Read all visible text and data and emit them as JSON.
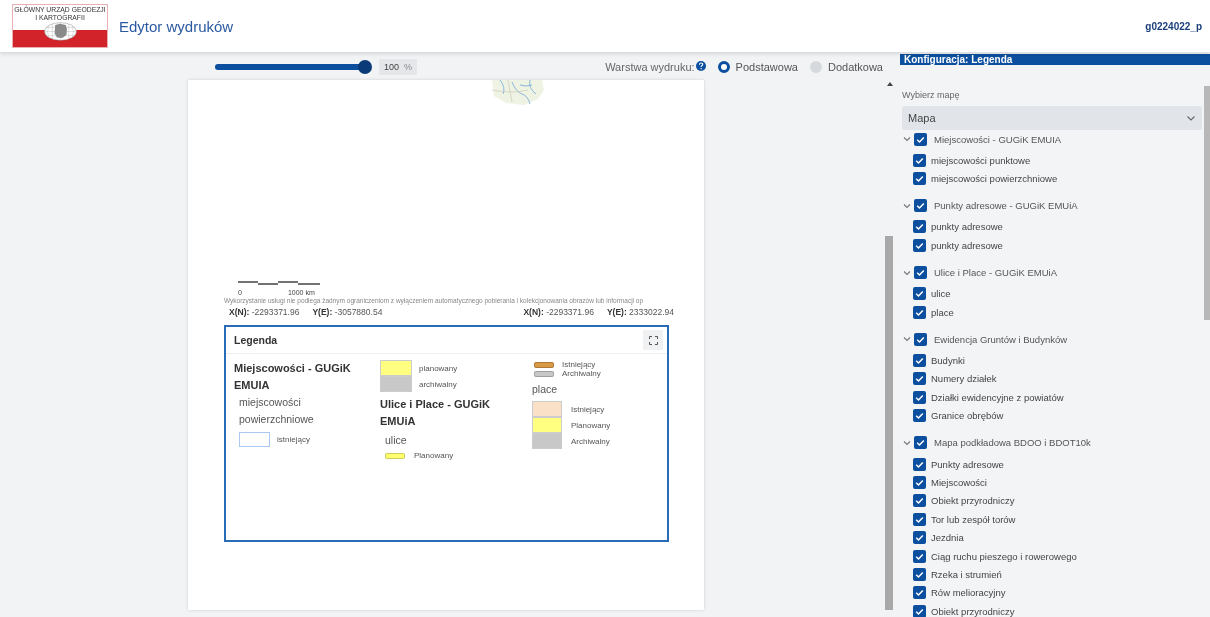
{
  "header": {
    "logo_caption": "GŁÓWNY URZĄD GEODEZJI I KARTOGRAFII",
    "title": "Edytor wydruków",
    "user": "g0224022_p"
  },
  "toolbar": {
    "zoom": {
      "level": 1,
      "value": "100",
      "unit": "%"
    },
    "layer_label": "Warstwa wydruku:",
    "layers": [
      {
        "label": "Podstawowa",
        "selected": true
      },
      {
        "label": "Dodatkowa",
        "selected": false
      }
    ]
  },
  "page": {
    "scale": {
      "start": "0",
      "end": "1000 km"
    },
    "attribution": "Wykorzystanie usługi nie podlega żadnym ograniczeniom z wyłączeniem automatycznego pobierania i kolekcjonowania obrazów lub informacji op",
    "coordinates": [
      [
        {
          "label": "X(N):",
          "value": "-2293371.96"
        },
        {
          "label": "Y(E):",
          "value": "-3057880.54"
        }
      ],
      [
        {
          "label": "X(N):",
          "value": "-2293371.96"
        },
        {
          "label": "Y(E):",
          "value": "2333022.94"
        }
      ]
    ]
  },
  "legend": {
    "title": "Legenda",
    "columns": [
      [
        {
          "kind": "heading",
          "text": "Miejscowości - GUGiK EMUIA"
        },
        {
          "kind": "label",
          "text": "miejscowości powierzchniowe"
        },
        {
          "kind": "outline",
          "text": "istniejący",
          "color": "#a9c8f2"
        }
      ],
      [
        {
          "kind": "swatch",
          "text": "planowany",
          "color": "#ffff80"
        },
        {
          "kind": "swatch",
          "text": "archiwalny",
          "color": "#c8c8c8"
        },
        {
          "kind": "heading",
          "text": "Ulice i Place - GUGiK EMUiA"
        },
        {
          "kind": "label",
          "text": "ulice"
        },
        {
          "kind": "line",
          "text": "Planowany",
          "color": "#ffff70"
        }
      ],
      [
        {
          "kind": "line",
          "text": "Istniejący",
          "color": "#d99a45"
        },
        {
          "kind": "line",
          "text": "Archiwalny",
          "color": "#c8c8c8"
        },
        {
          "kind": "label",
          "text": "place"
        },
        {
          "kind": "swatch",
          "text": "Istniejący",
          "color": "#fbe0c8"
        },
        {
          "kind": "swatch",
          "text": "Planowany",
          "color": "#ffff80"
        },
        {
          "kind": "swatch",
          "text": "Archiwalny",
          "color": "#c8c8c8"
        }
      ]
    ]
  },
  "config": {
    "title": "Konfiguracja: Legenda",
    "map_label": "Wybierz mapę",
    "map_value": "Mapa",
    "groups": [
      {
        "label": "Miejscowości - GUGiK EMUIA",
        "checked": true,
        "expanded": true,
        "children": [
          {
            "label": "miejscowości punktowe",
            "checked": true
          },
          {
            "label": "miejscowości powierzchniowe",
            "checked": true
          }
        ]
      },
      {
        "label": "Punkty adresowe - GUGiK EMUiA",
        "checked": true,
        "expanded": true,
        "children": [
          {
            "label": "punkty adresowe",
            "checked": true
          },
          {
            "label": "punkty adresowe",
            "checked": true
          }
        ]
      },
      {
        "label": "Ulice i Place - GUGiK EMUiA",
        "checked": true,
        "expanded": true,
        "children": [
          {
            "label": "ulice",
            "checked": true
          },
          {
            "label": "place",
            "checked": true
          }
        ]
      },
      {
        "label": "Ewidencja Gruntów i Budynków",
        "checked": true,
        "expanded": true,
        "children": [
          {
            "label": "Budynki",
            "checked": true
          },
          {
            "label": "Numery działek",
            "checked": true
          },
          {
            "label": "Działki ewidencyjne z powiatów",
            "checked": true
          },
          {
            "label": "Granice obrębów",
            "checked": true
          }
        ]
      },
      {
        "label": "Mapa podkładowa BDOO i BDOT10k",
        "checked": true,
        "expanded": true,
        "children": [
          {
            "label": "Punkty adresowe",
            "checked": true
          },
          {
            "label": "Miejscowości",
            "checked": true
          },
          {
            "label": "Obiekt przyrodniczy",
            "checked": true
          },
          {
            "label": "Tor lub zespół torów",
            "checked": true
          },
          {
            "label": "Jezdnia",
            "checked": true
          },
          {
            "label": "Ciąg ruchu pieszego i rowerowego",
            "checked": true
          },
          {
            "label": "Rzeka i strumień",
            "checked": true
          },
          {
            "label": "Rów melioracyjny",
            "checked": true
          },
          {
            "label": "Obiekt przyrodniczy",
            "checked": true
          }
        ]
      }
    ]
  }
}
